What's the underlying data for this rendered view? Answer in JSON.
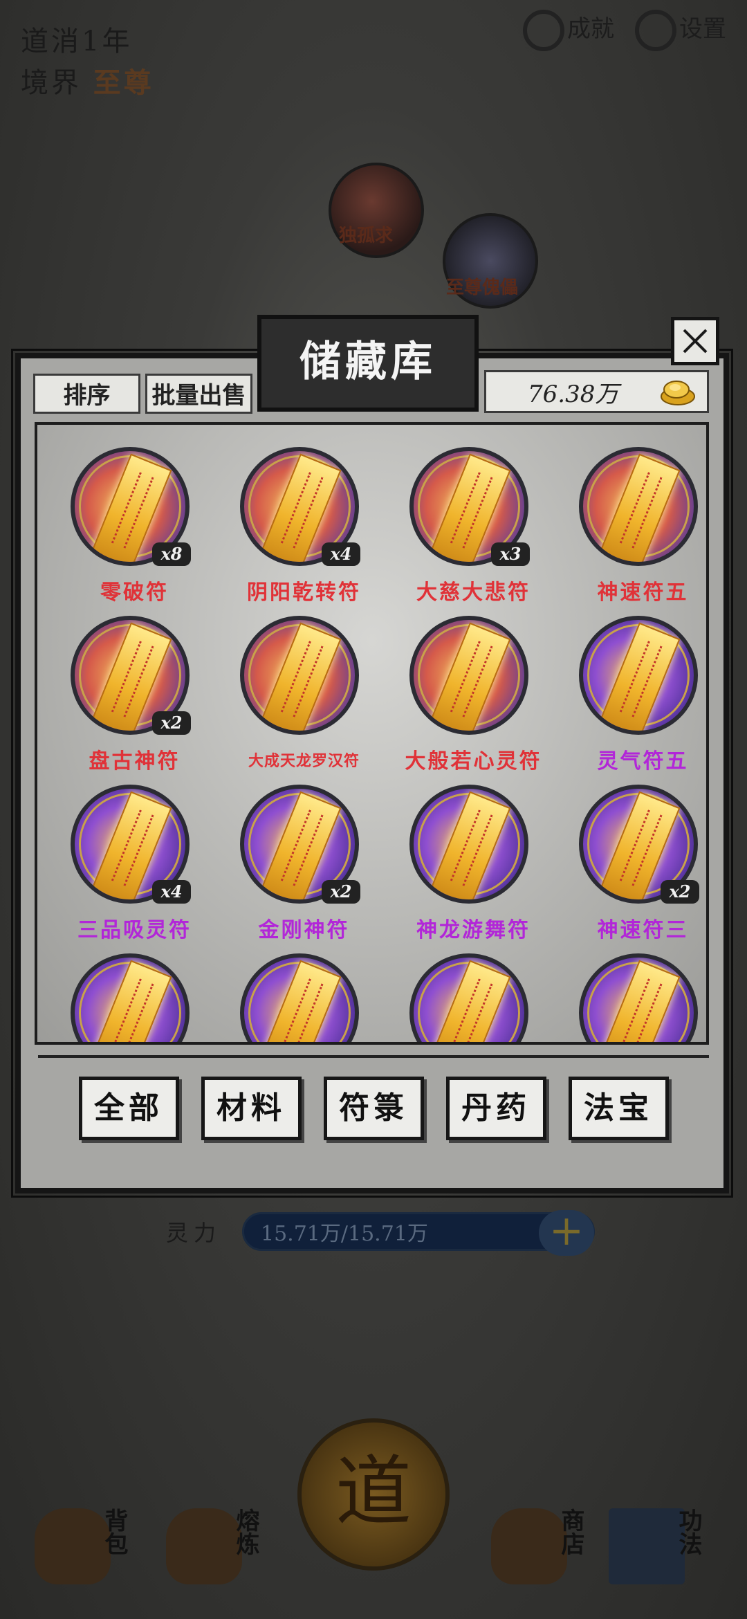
{
  "background": {
    "year_label": "道消1年",
    "realm_label": "境界",
    "realm_value": "至尊",
    "achievement_label": "成就",
    "settings_label": "设置",
    "orb_1_label": "独孤求",
    "orb_2_label": "至尊傀儡",
    "spirit_label": "灵力",
    "spirit_value": "15.71万/15.71万",
    "center_button": "道",
    "nav": [
      "背包",
      "熔炼",
      "商店",
      "功法"
    ]
  },
  "dialog": {
    "title": "储藏库",
    "sort_label": "排序",
    "batch_sell_label": "批量出售",
    "gold_amount": "76.38万",
    "items": [
      {
        "name": "零破符",
        "count": "x8",
        "rarity": "red"
      },
      {
        "name": "阴阳乾转符",
        "count": "x4",
        "rarity": "red"
      },
      {
        "name": "大慈大悲符",
        "count": "x3",
        "rarity": "red"
      },
      {
        "name": "神速符五",
        "count": "",
        "rarity": "red"
      },
      {
        "name": "盘古神符",
        "count": "x2",
        "rarity": "red"
      },
      {
        "name": "大成天龙罗汉符",
        "count": "",
        "rarity": "red"
      },
      {
        "name": "大般若心灵符",
        "count": "",
        "rarity": "red"
      },
      {
        "name": "灵气符五",
        "count": "",
        "rarity": "purple"
      },
      {
        "name": "三品吸灵符",
        "count": "x4",
        "rarity": "purple"
      },
      {
        "name": "金刚神符",
        "count": "x2",
        "rarity": "purple"
      },
      {
        "name": "神龙游舞符",
        "count": "",
        "rarity": "purple"
      },
      {
        "name": "神速符三",
        "count": "x2",
        "rarity": "purple"
      },
      {
        "name": "",
        "count": "",
        "rarity": "purple"
      },
      {
        "name": "",
        "count": "",
        "rarity": "purple"
      },
      {
        "name": "",
        "count": "",
        "rarity": "purple"
      },
      {
        "name": "",
        "count": "",
        "rarity": "purple"
      }
    ],
    "filters": [
      "全部",
      "材料",
      "符箓",
      "丹药",
      "法宝"
    ]
  },
  "colors": {
    "red_rarity": "#e03238",
    "purple_rarity": "#b226d8"
  }
}
